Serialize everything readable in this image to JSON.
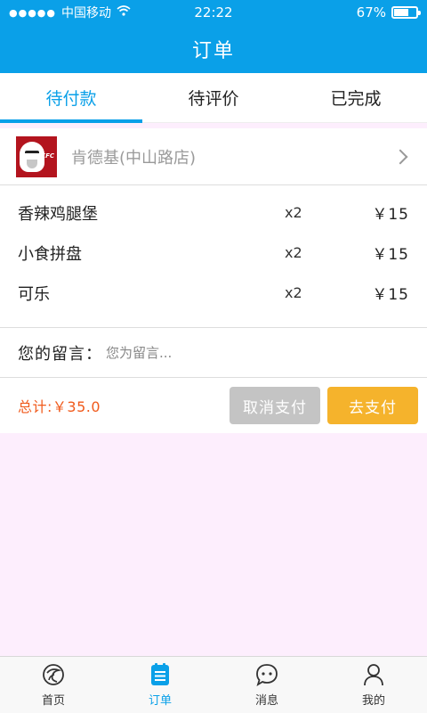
{
  "status": {
    "carrier": "中国移动",
    "time": "22:22",
    "battery": "67%",
    "battery_level": 0.67
  },
  "nav": {
    "title": "订单"
  },
  "tabs": [
    {
      "label": "待付款",
      "active": true
    },
    {
      "label": "待评价",
      "active": false
    },
    {
      "label": "已完成",
      "active": false
    }
  ],
  "order": {
    "shop_name": "肯德基(中山路店)",
    "logo_text": "KFC",
    "items": [
      {
        "name": "香辣鸡腿堡",
        "qty": "x2",
        "price": "￥15"
      },
      {
        "name": "小食拼盘",
        "qty": "x2",
        "price": "￥15"
      },
      {
        "name": "可乐",
        "qty": "x2",
        "price": "￥15"
      }
    ],
    "message_label": "您的留言：",
    "message_placeholder": "您为留言...",
    "total": "总计:￥35.0",
    "cancel_label": "取消支付",
    "pay_label": "去支付"
  },
  "tabbar": [
    {
      "label": "首页",
      "icon": "home-icon",
      "active": false
    },
    {
      "label": "订单",
      "icon": "order-icon",
      "active": true
    },
    {
      "label": "消息",
      "icon": "message-icon",
      "active": false
    },
    {
      "label": "我的",
      "icon": "profile-icon",
      "active": false
    }
  ],
  "colors": {
    "primary": "#0aa0e8",
    "pay": "#f5b32c",
    "cancel": "#c4c4c4",
    "total": "#f05a1c",
    "background": "#fdeefd"
  }
}
